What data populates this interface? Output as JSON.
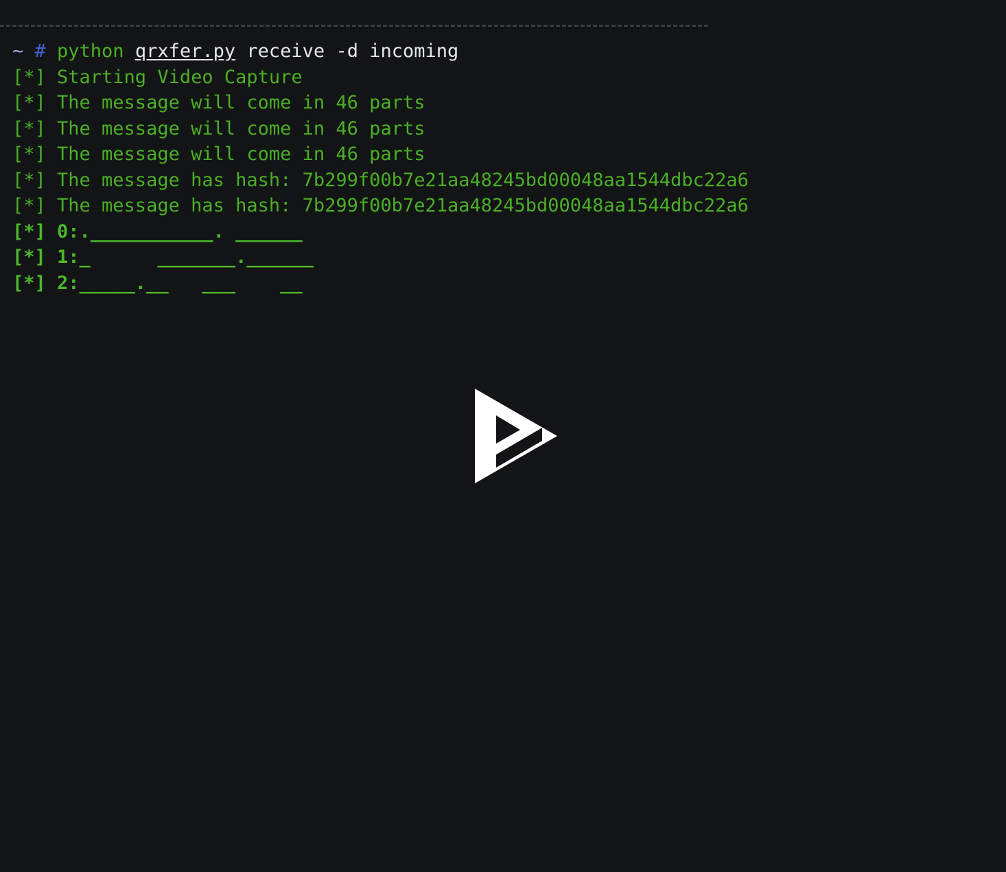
{
  "terminal": {
    "background_color": "#131415",
    "foreground_color": "#cfd0d1",
    "green_color": "#4aaf26",
    "bold_green_color": "#4cb82a",
    "prompt_hash_color": "#4a5fd6",
    "prompt_tilde_color": "#9ea7f0",
    "separator_color": "#3a3c3e"
  },
  "prompt": {
    "tilde": "~ ",
    "hash": "# ",
    "command_name": "python ",
    "script": "qrxfer.py",
    "args": " receive -d incoming"
  },
  "log_lines": [
    "[*] Starting Video Capture",
    "[*] The message will come in 46 parts",
    "[*] The message will come in 46 parts",
    "[*] The message will come in 46 parts",
    "[*] The message has hash: 7b299f00b7e21aa48245bd00048aa1544dbc22a6",
    "[*] The message has hash: 7b299f00b7e21aa48245bd00048aa1544dbc22a6"
  ],
  "progress_lines": [
    "[*] 0:.___________. ______",
    "[*] 1:_      _______.______",
    "[*] 2:_____.__   ___    __"
  ],
  "details": {
    "part_count": "46",
    "message_hash": "7b299f00b7e21aa48245bd00048aa1544dbc22a6",
    "command_full": "python qrxfer.py receive -d incoming"
  },
  "player": {
    "logo_name": "asciinema-play-logo",
    "logo_color": "#ffffff",
    "state_label": "play"
  }
}
